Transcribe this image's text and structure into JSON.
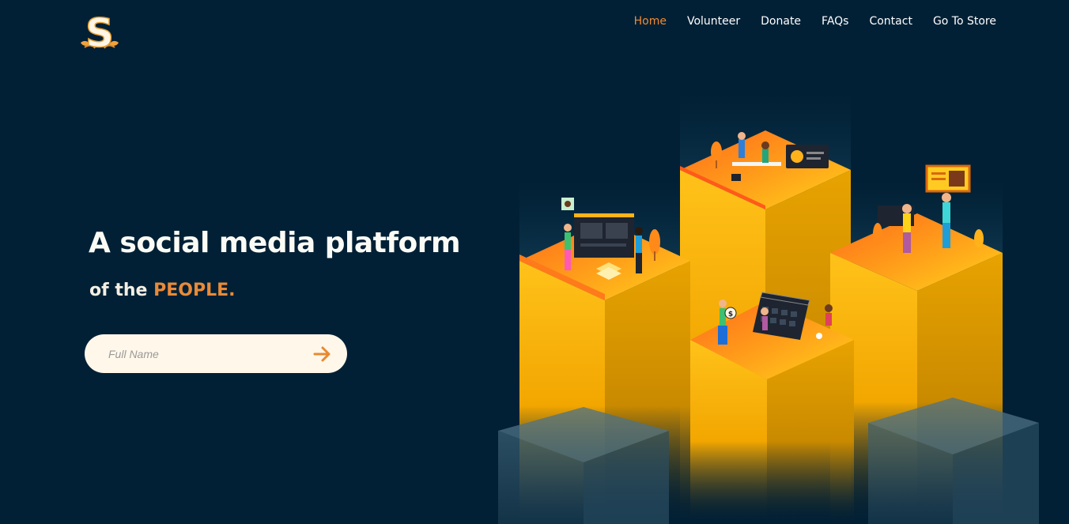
{
  "header": {
    "logo_letter": "S",
    "nav": [
      {
        "label": "Home",
        "active": true
      },
      {
        "label": "Volunteer",
        "active": false
      },
      {
        "label": "Donate",
        "active": false
      },
      {
        "label": "FAQs",
        "active": false
      },
      {
        "label": "Contact",
        "active": false
      },
      {
        "label": "Go To Store",
        "active": false
      }
    ]
  },
  "hero": {
    "title": "A social media platform",
    "subtitle_prefix": "of the",
    "subtitle_highlight": "PEOPLE."
  },
  "signup": {
    "placeholder": "Full Name",
    "submit_icon": "arrow-right-icon"
  },
  "illustration": {
    "icon": "isometric-community-illustration",
    "sign_value": "$"
  },
  "colors": {
    "background": "#022035",
    "accent": "#f28a30",
    "highlight": "#e98a39",
    "input_background": "#fff7ea"
  }
}
